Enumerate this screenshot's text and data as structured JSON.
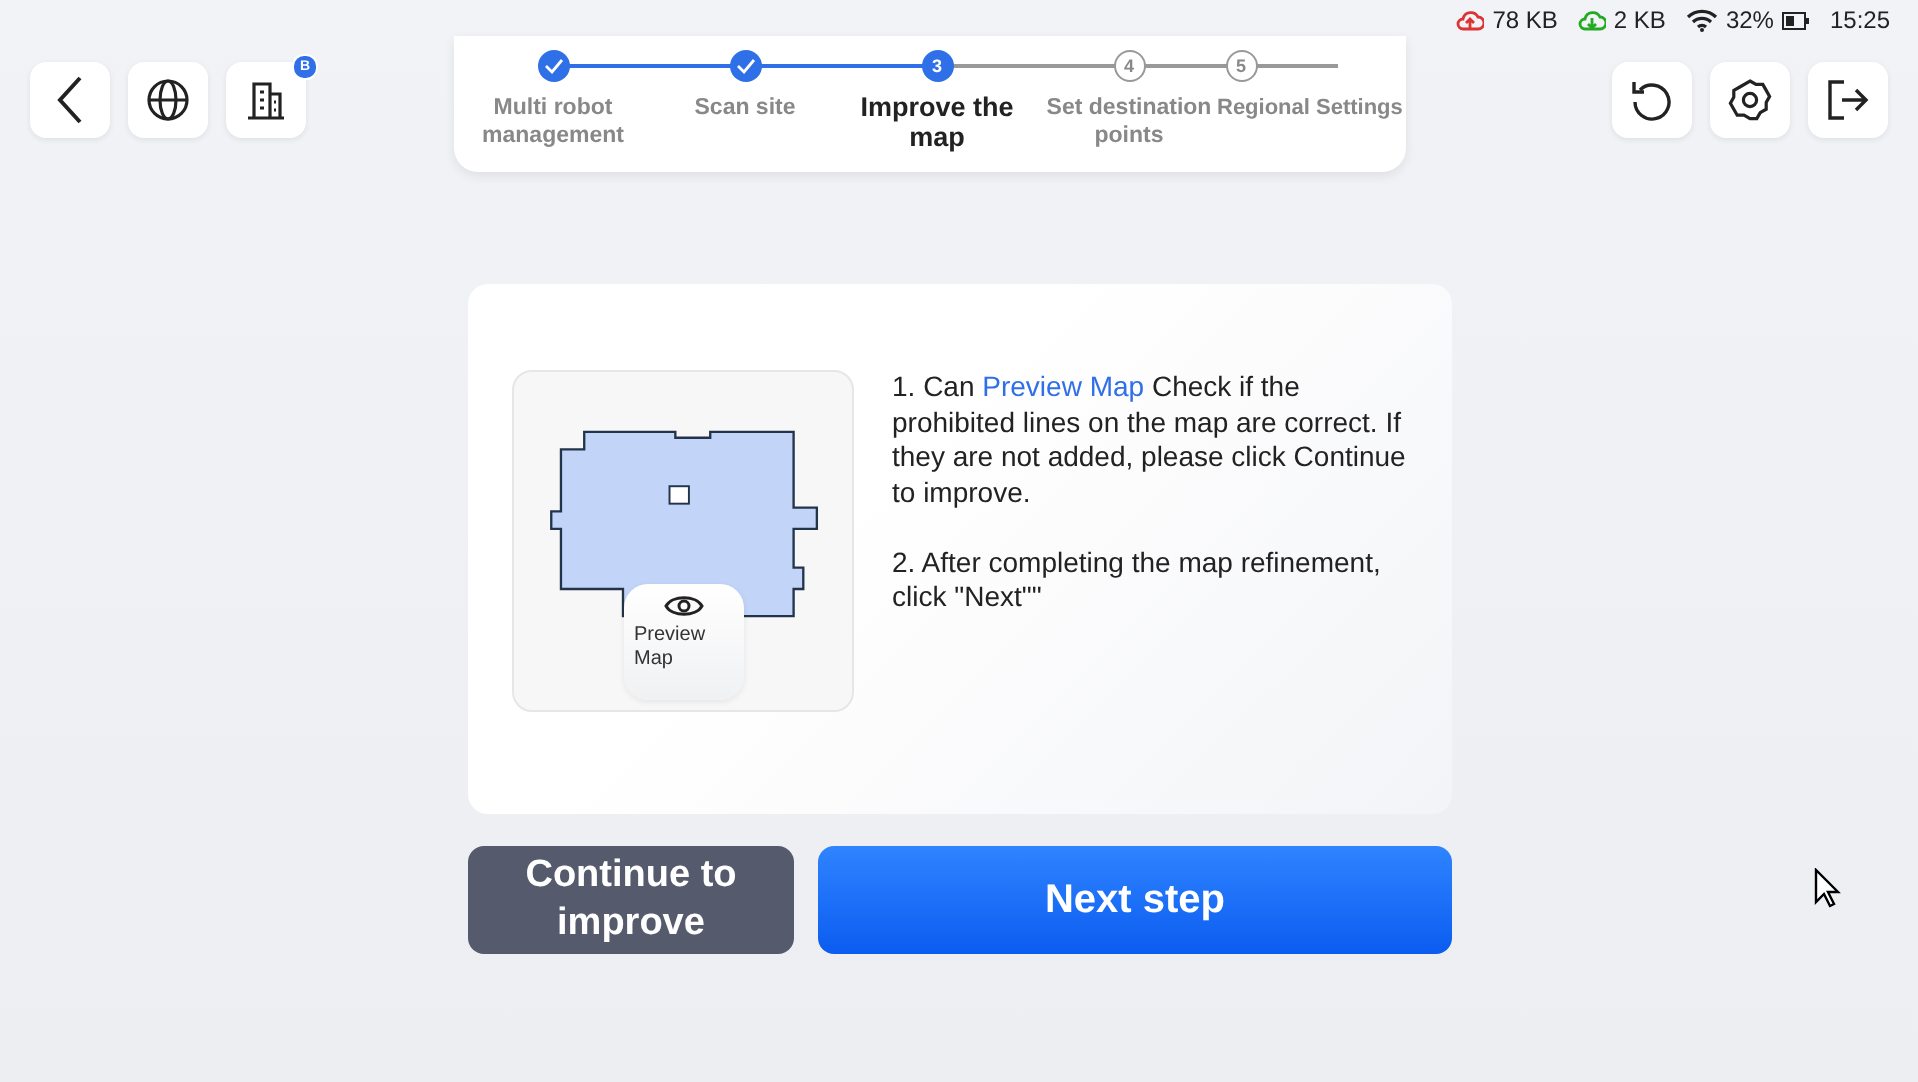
{
  "status_bar": {
    "upload": "78 KB",
    "download": "2 KB",
    "battery": "32%",
    "time": "15:25"
  },
  "toolbar": {
    "badge": "B"
  },
  "steps": [
    {
      "label": "Multi robot management",
      "completed": true,
      "selected": false
    },
    {
      "label": "Scan site",
      "completed": true,
      "selected": false
    },
    {
      "label": "Improve the map",
      "number": "3",
      "completed": false,
      "selected": true
    },
    {
      "label": "Set destination points",
      "number": "4",
      "completed": false,
      "selected": false
    },
    {
      "label": "Regional Settings",
      "number": "5",
      "completed": false,
      "selected": false
    }
  ],
  "preview": {
    "label": "Preview Map"
  },
  "instructions": [
    {
      "kind": "link",
      "before": "1. Can ",
      "link": "Preview Map",
      "after": " Check if the prohibited lines on the map are correct. If they are not added, please click Continue to improve."
    },
    {
      "kind": "plain",
      "text": "2. After completing the map refinement, click \"Next\"\""
    }
  ],
  "buttons": [
    {
      "label": "Continue to improve",
      "kind": "secondary"
    },
    {
      "label": "Next step",
      "kind": "primary"
    }
  ]
}
